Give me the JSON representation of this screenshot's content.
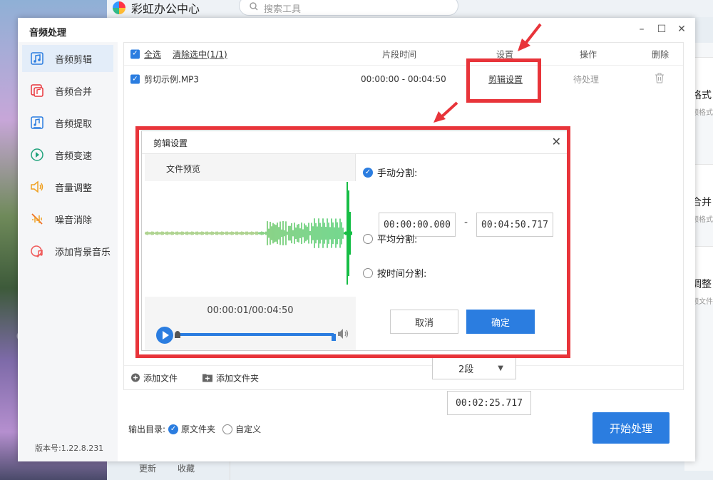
{
  "background_app": {
    "title": "彩虹办公中心",
    "search_placeholder": "搜索工具",
    "right_cards": [
      {
        "title": "格式",
        "sub": "频格式"
      },
      {
        "title": "合并",
        "sub": "频格式"
      },
      {
        "title": "调整",
        "sub": "频文件"
      }
    ],
    "footer_links": [
      "更新",
      "收藏"
    ]
  },
  "window": {
    "title": "音频处理",
    "controls": [
      "–",
      "☐",
      "✕"
    ],
    "version": "版本号:1.22.8.231"
  },
  "sidebar": {
    "items": [
      {
        "label": "音频剪辑",
        "icon": "audio-clip-icon",
        "color": "#2b7de0",
        "active": true
      },
      {
        "label": "音频合并",
        "icon": "audio-merge-icon",
        "color": "#e8343a"
      },
      {
        "label": "音频提取",
        "icon": "audio-extract-icon",
        "color": "#2b7de0"
      },
      {
        "label": "音频变速",
        "icon": "audio-speed-icon",
        "color": "#20a37c"
      },
      {
        "label": "音量调整",
        "icon": "volume-icon",
        "color": "#f0a020"
      },
      {
        "label": "噪音消除",
        "icon": "noise-cancel-icon",
        "color": "#f07020"
      },
      {
        "label": "添加背景音乐",
        "icon": "bg-music-icon",
        "color": "#f05a5a"
      }
    ]
  },
  "table": {
    "select_all": "全选",
    "clear_selected": "清除选中(1/1)",
    "col_time": "片段时间",
    "col_settings": "设置",
    "col_action": "操作",
    "col_delete": "删除",
    "row": {
      "file": "剪切示例.MP3",
      "time": "00:00:00 - 00:04:50",
      "settings": "剪辑设置",
      "status": "待处理"
    },
    "add_file": "添加文件",
    "add_folder": "添加文件夹"
  },
  "output": {
    "label": "输出目录:",
    "option_source": "原文件夹",
    "option_custom": "自定义",
    "start": "开始处理"
  },
  "dialog": {
    "title": "剪辑设置",
    "preview_label": "文件预览",
    "player_time": "00:00:01/00:04:50",
    "manual_split": "手动分割:",
    "manual_start": "00:00:00.000",
    "manual_dash": "-",
    "manual_end": "00:04:50.717",
    "avg_split": "平均分割:",
    "avg_value": "2段",
    "time_split": "按时间分割:",
    "time_value": "00:02:25.717",
    "cancel": "取消",
    "ok": "确定"
  },
  "colors": {
    "accent": "#2b7de0",
    "annotation": "#e8343a"
  }
}
